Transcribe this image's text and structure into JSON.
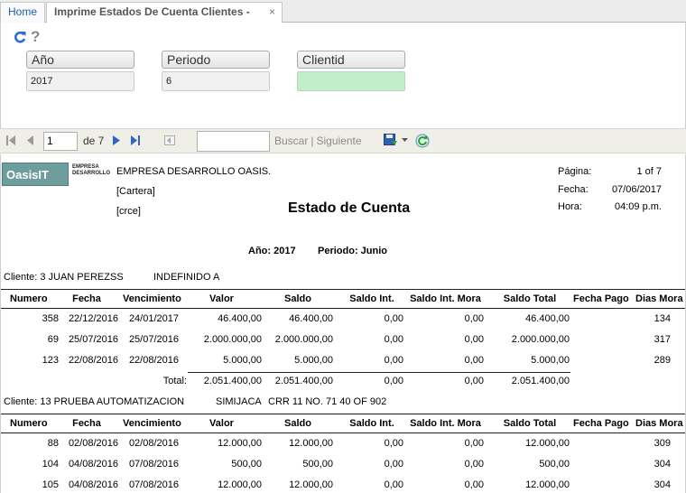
{
  "tabs": [
    {
      "label": "Home"
    },
    {
      "label": "Imprime Estados De Cuenta Clientes -[crec]",
      "close": "×"
    }
  ],
  "params": {
    "help": "?",
    "fields": [
      {
        "label": "Año",
        "value": "2017"
      },
      {
        "label": "Periodo",
        "value": "6"
      },
      {
        "label": "Clientid",
        "value": ""
      }
    ]
  },
  "toolbar": {
    "page": "1",
    "of": "de 7",
    "search_label": "Buscar",
    "next_label": "Siguiente",
    "separator": "|"
  },
  "report": {
    "logo_text": "OasisIT",
    "logo_sub1": "EMPRESA",
    "logo_sub2": "DESARROLLO",
    "company": "EMPRESA DESARROLLO OASIS.",
    "line2": "[Cartera]",
    "line3": "[crce]",
    "title": "Estado de Cuenta",
    "meta": {
      "page_label": "Página:",
      "page_value": "1 of 7",
      "date_label": "Fecha:",
      "date_value": "07/06/2017",
      "time_label": "Hora:",
      "time_value": "04:09 p.m."
    },
    "year_label": "Año: 2017",
    "period_label": "Periodo: Junio",
    "columns": [
      "Numero",
      "Fecha",
      "Vencimiento",
      "Valor",
      "Saldo",
      "Saldo Int.",
      "Saldo Int. Mora",
      "Saldo Total",
      "Fecha Pago",
      "Dias Mora"
    ],
    "clients": [
      {
        "header": "Cliente:  3  JUAN PEREZSS",
        "extra1": "INDEFINIDO   A",
        "extra2": "",
        "rows": [
          [
            "358",
            "22/12/2016",
            "24/01/2017",
            "46.400,00",
            "46.400,00",
            "0,00",
            "0,00",
            "46.400,00",
            "",
            "134"
          ],
          [
            "69",
            "25/07/2016",
            "25/07/2016",
            "2.000.000,00",
            "2.000.000,00",
            "0,00",
            "0,00",
            "2.000.000,00",
            "",
            "317"
          ],
          [
            "123",
            "22/08/2016",
            "22/08/2016",
            "5.000,00",
            "5.000,00",
            "0,00",
            "0,00",
            "5.000,00",
            "",
            "289"
          ]
        ],
        "total": {
          "label": "Total:",
          "values": [
            "2.051.400,00",
            "2.051.400,00",
            "0,00",
            "0,00",
            "2.051.400,00"
          ]
        }
      },
      {
        "header": "Cliente:  13  PRUEBA AUTOMATIZACION",
        "extra1": "SIMIJACA",
        "extra2": "CRR 11 NO. 71 40 OF 902",
        "rows": [
          [
            "88",
            "02/08/2016",
            "02/08/2016",
            "12.000,00",
            "12.000,00",
            "0,00",
            "0,00",
            "12.000,00",
            "",
            "309"
          ],
          [
            "104",
            "04/08/2016",
            "07/08/2016",
            "500,00",
            "500,00",
            "0,00",
            "0,00",
            "500,00",
            "",
            "304"
          ],
          [
            "105",
            "04/08/2016",
            "07/08/2016",
            "12.000,00",
            "12.000,00",
            "0,00",
            "0,00",
            "12.000,00",
            "",
            "304"
          ]
        ]
      }
    ]
  }
}
